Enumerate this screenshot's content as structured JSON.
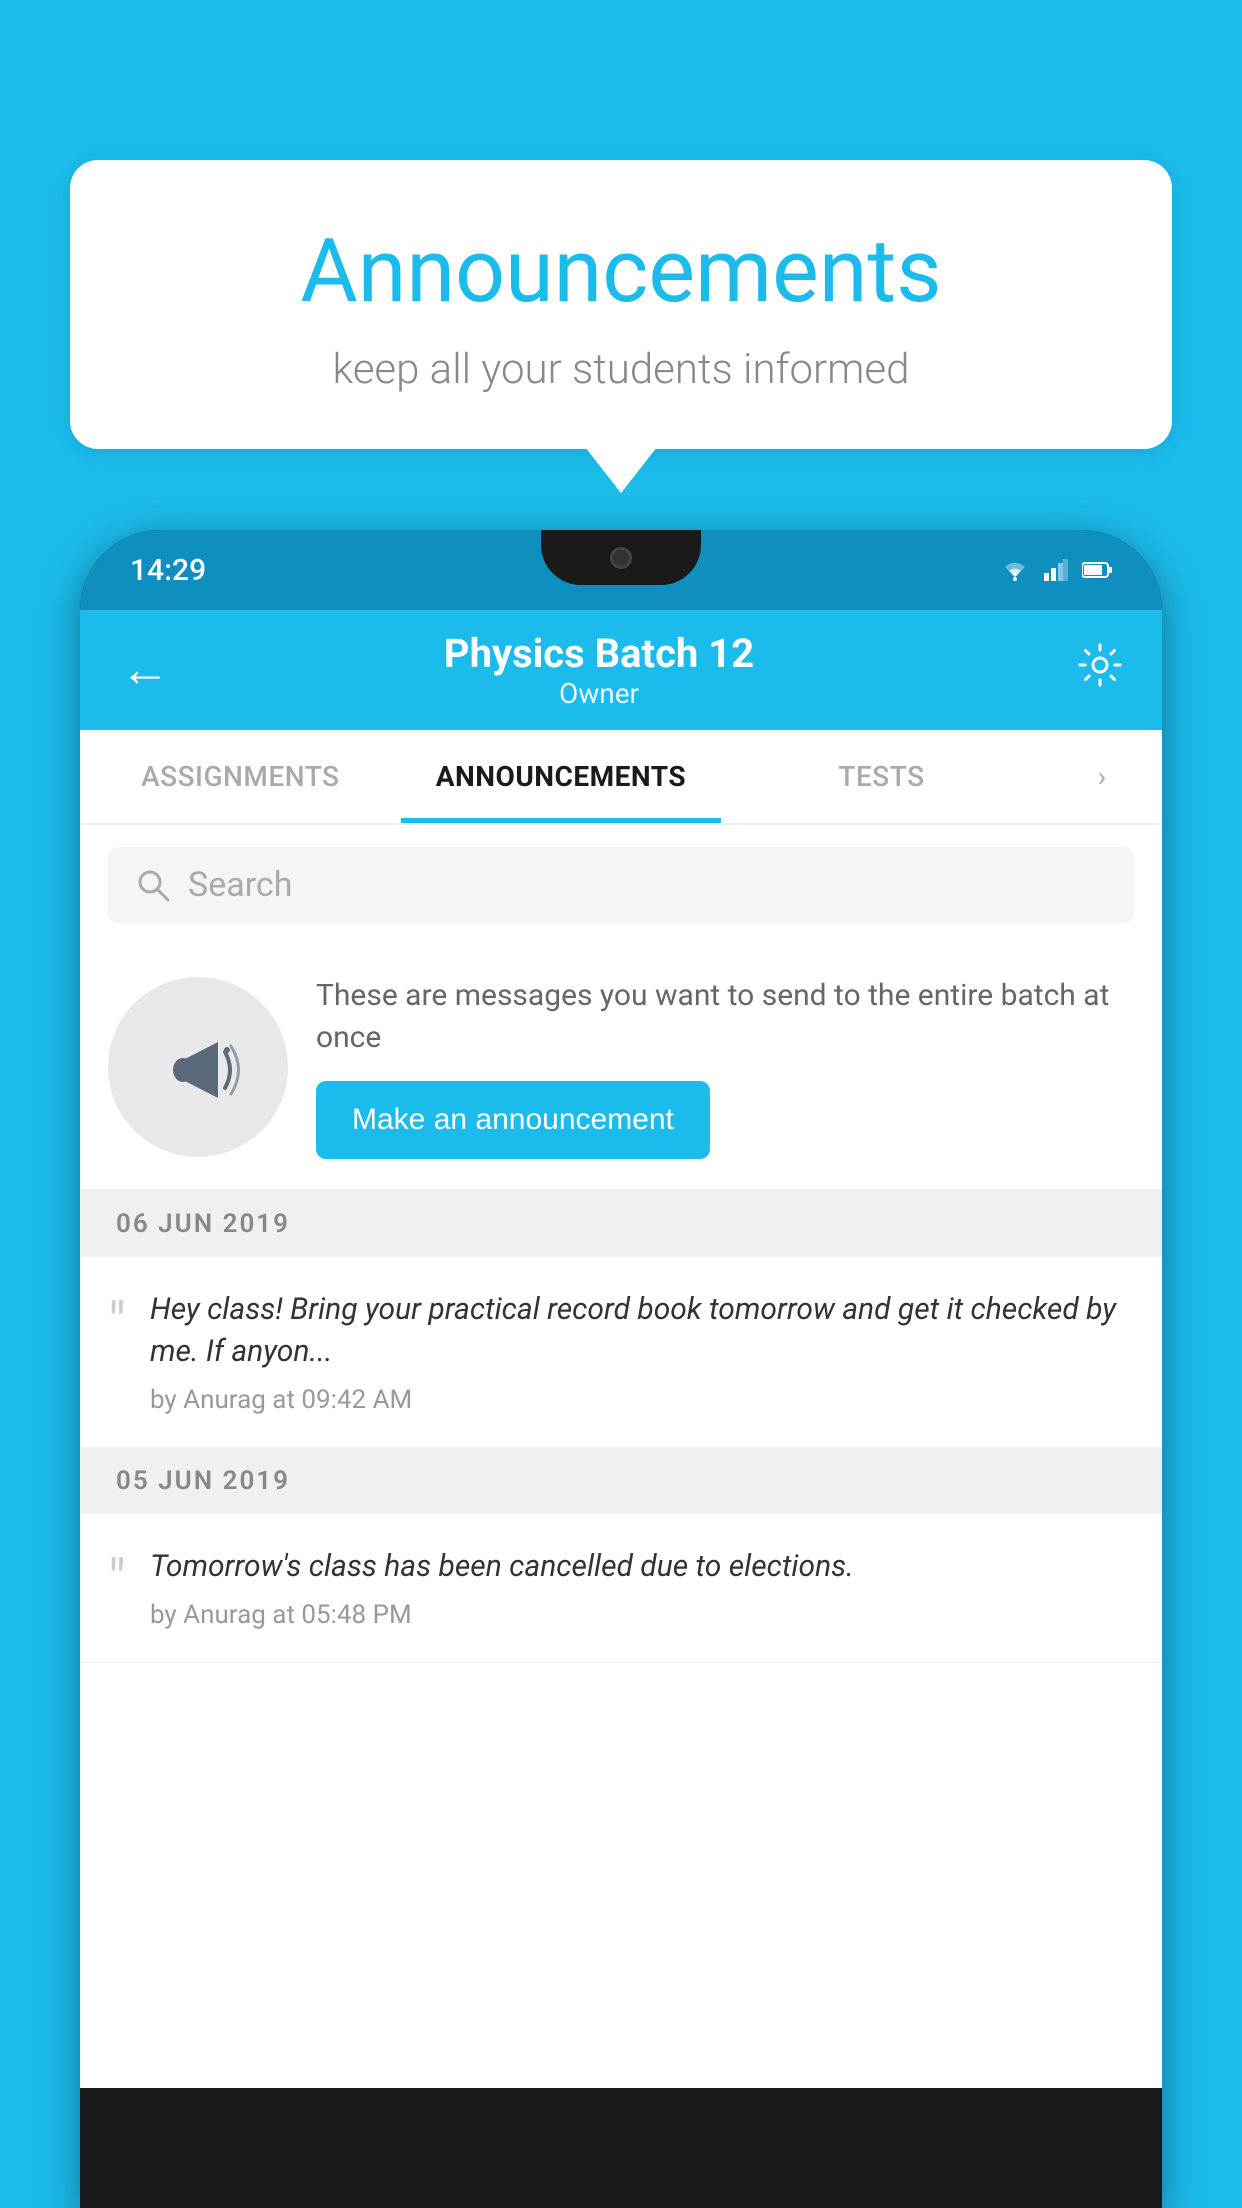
{
  "background_color": "#1BBBEC",
  "speech_bubble": {
    "title": "Announcements",
    "subtitle": "keep all your students informed"
  },
  "phone": {
    "status_bar": {
      "time": "14:29"
    },
    "app_bar": {
      "title": "Physics Batch 12",
      "subtitle": "Owner",
      "back_icon": "←",
      "gear_icon": "⚙"
    },
    "tabs": [
      {
        "label": "ASSIGNMENTS",
        "active": false
      },
      {
        "label": "ANNOUNCEMENTS",
        "active": true
      },
      {
        "label": "TESTS",
        "active": false
      }
    ],
    "tabs_more": "›",
    "search": {
      "placeholder": "Search"
    },
    "announcement_promo": {
      "description": "These are messages you want to send to the entire batch at once",
      "button_label": "Make an announcement"
    },
    "announcement_groups": [
      {
        "date": "06  JUN  2019",
        "items": [
          {
            "text": "Hey class! Bring your practical record book tomorrow and get it checked by me. If anyon...",
            "meta": "by Anurag at 09:42 AM"
          }
        ]
      },
      {
        "date": "05  JUN  2019",
        "items": [
          {
            "text": "Tomorrow's class has been cancelled due to elections.",
            "meta": "by Anurag at 05:48 PM"
          }
        ]
      }
    ]
  }
}
